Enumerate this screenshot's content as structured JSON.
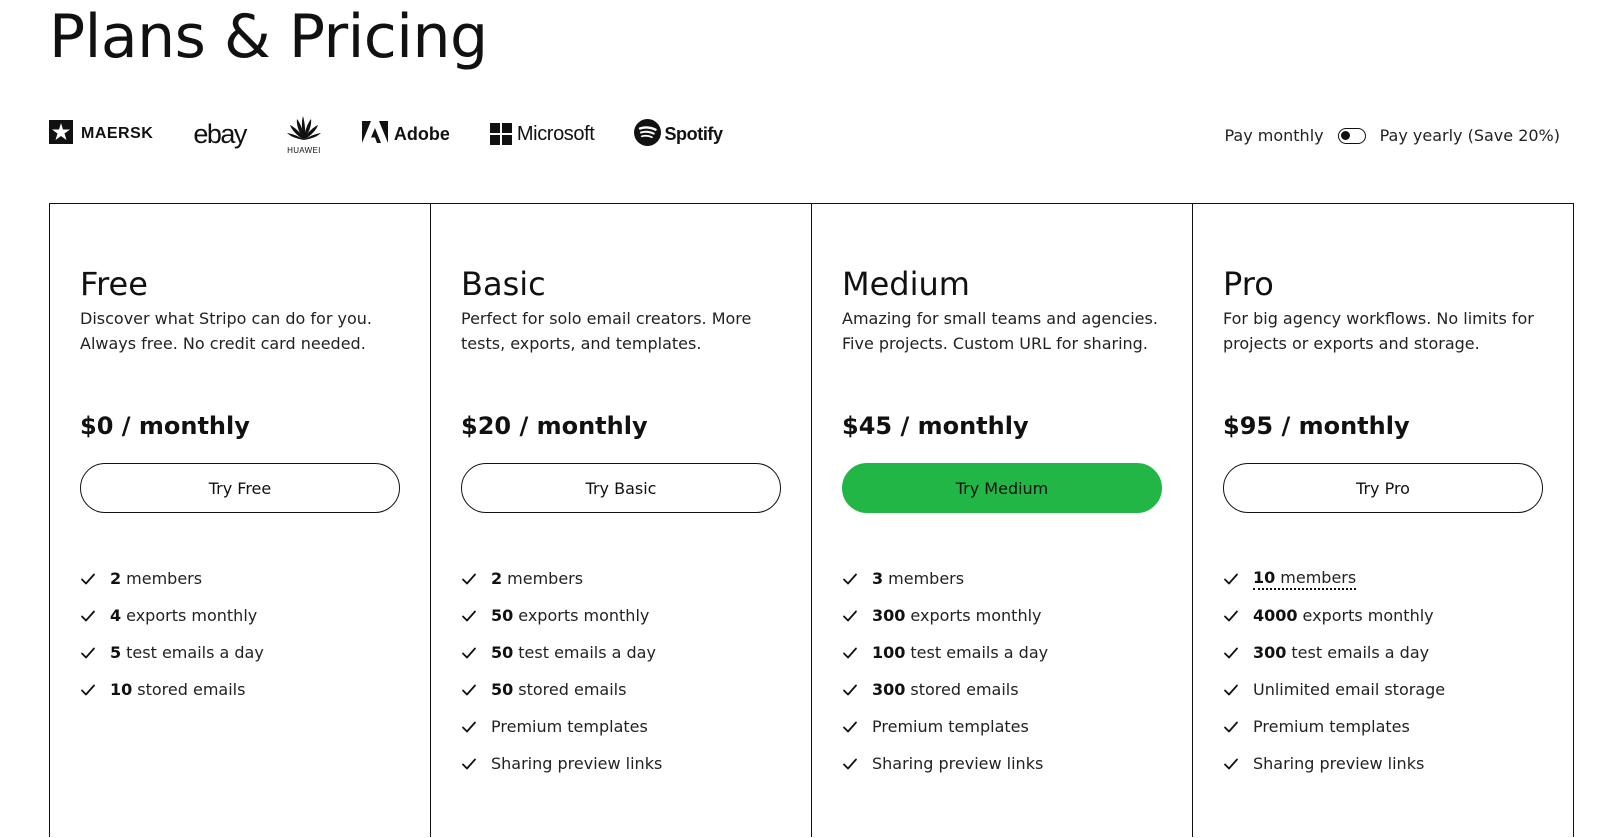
{
  "page": {
    "title": "Plans & Pricing"
  },
  "logos": [
    {
      "name": "MAERSK",
      "icon": "maersk-star-icon"
    },
    {
      "name": "ebay"
    },
    {
      "name": "HUAWEI",
      "icon": "huawei-petals-icon"
    },
    {
      "name": "Adobe",
      "icon": "adobe-a-icon"
    },
    {
      "name": "Microsoft",
      "icon": "microsoft-grid-icon"
    },
    {
      "name": "Spotify",
      "icon": "spotify-circle-icon"
    }
  ],
  "billing": {
    "monthly_label": "Pay monthly",
    "yearly_label": "Pay yearly (Save 20%)",
    "selected": "monthly"
  },
  "colors": {
    "accent": "#22b646",
    "text": "#111111",
    "border": "#111111"
  },
  "plans": [
    {
      "name": "Free",
      "description": "Discover what Stripo can do for you. Always free. No credit card needed.",
      "price": "$0 / monthly",
      "button": "Try Free",
      "primary": false,
      "features": [
        {
          "bold": "2",
          "text": "members"
        },
        {
          "bold": "4",
          "text": "exports monthly"
        },
        {
          "bold": "5",
          "text": "test emails a day"
        },
        {
          "bold": "10",
          "text": "stored emails"
        }
      ]
    },
    {
      "name": "Basic",
      "description": "Perfect for solo email creators. More tests, exports, and templates.",
      "price": "$20 / monthly",
      "button": "Try Basic",
      "primary": false,
      "features": [
        {
          "bold": "2",
          "text": "members"
        },
        {
          "bold": "50",
          "text": "exports monthly"
        },
        {
          "bold": "50",
          "text": "test emails a day"
        },
        {
          "bold": "50",
          "text": "stored emails"
        },
        {
          "bold": "",
          "text": "Premium templates"
        },
        {
          "bold": "",
          "text": "Sharing preview links"
        }
      ]
    },
    {
      "name": "Medium",
      "description": "Amazing for small teams and agencies. Five projects. Custom URL for sharing.",
      "price": "$45 / monthly",
      "button": "Try Medium",
      "primary": true,
      "features": [
        {
          "bold": "3",
          "text": "members"
        },
        {
          "bold": "300",
          "text": "exports monthly"
        },
        {
          "bold": "100",
          "text": "test emails a day"
        },
        {
          "bold": "300",
          "text": "stored emails"
        },
        {
          "bold": "",
          "text": "Premium templates"
        },
        {
          "bold": "",
          "text": "Sharing preview links"
        }
      ]
    },
    {
      "name": "Pro",
      "description": "For big agency workflows. No limits for projects or exports and storage.",
      "price": "$95 / monthly",
      "button": "Try Pro",
      "primary": false,
      "features": [
        {
          "bold": "10",
          "text": "members",
          "dotted": true
        },
        {
          "bold": "4000",
          "text": "exports monthly"
        },
        {
          "bold": "300",
          "text": "test emails a day"
        },
        {
          "bold": "",
          "text": "Unlimited email storage"
        },
        {
          "bold": "",
          "text": "Premium templates"
        },
        {
          "bold": "",
          "text": "Sharing preview links"
        }
      ]
    }
  ]
}
